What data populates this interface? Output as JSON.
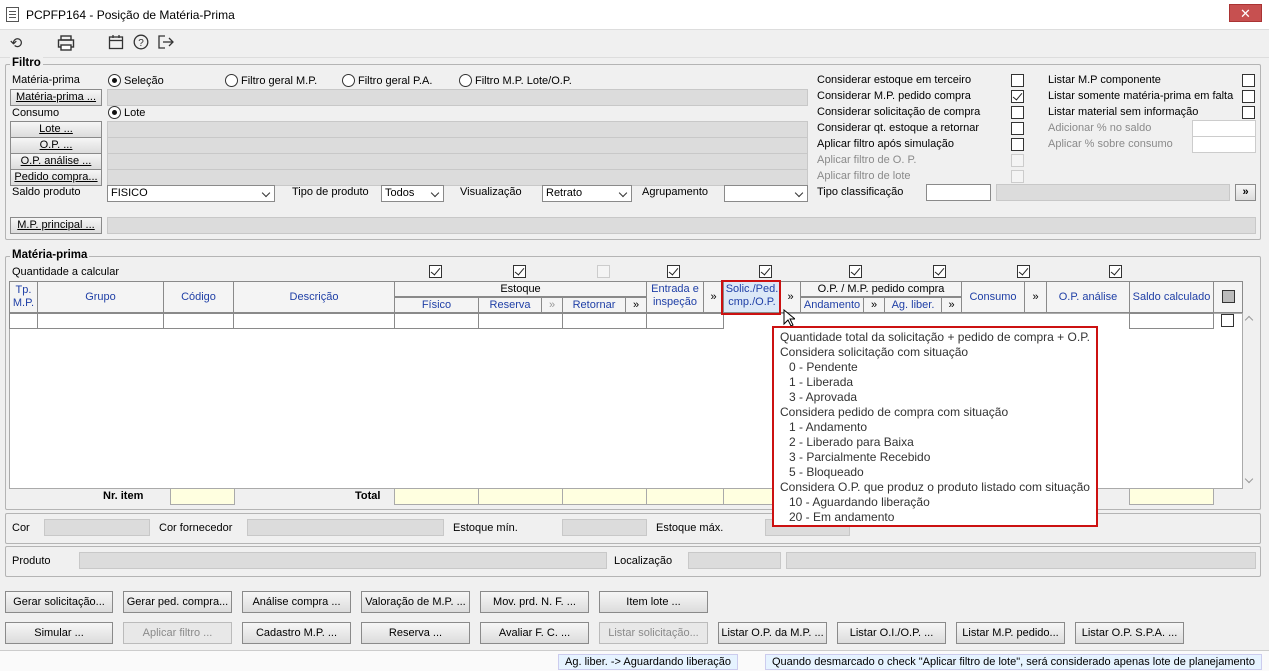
{
  "window": {
    "title": "PCPFP164 - Posição de Matéria-Prima",
    "close": "✕"
  },
  "toolbar": {
    "icons": [
      "refresh-icon",
      "print-icon",
      "calendar-icon",
      "help-icon",
      "exit-icon"
    ]
  },
  "filtro": {
    "title": "Filtro",
    "materia_prima_label": "Matéria-prima",
    "radios": [
      "Seleção",
      "Filtro geral M.P.",
      "Filtro geral P.A.",
      "Filtro M.P. Lote/O.P."
    ],
    "materia_prima_btn": "Matéria-prima ...",
    "consumo_label": "Consumo",
    "lote_radio": "Lote",
    "lote_btn": "Lote ...",
    "op_btn": "O.P. ...",
    "op_analise_btn": "O.P. análise ...",
    "pedido_btn": "Pedido compra...",
    "saldo_label": "Saldo produto",
    "saldo_value": "FISICO",
    "tipo_label": "Tipo de produto",
    "tipo_value": "Todos",
    "visual_label": "Visualização",
    "visual_value": "Retrato",
    "agrup_label": "Agrupamento",
    "agrup_value": "",
    "mp_principal_btn": "M.P. principal ...",
    "tipo_class_label": "Tipo classificação",
    "more": "»",
    "options_left": [
      {
        "label": "Considerar estoque em terceiro",
        "checked": false,
        "disabled": false
      },
      {
        "label": "Considerar M.P. pedido compra",
        "checked": true,
        "disabled": false
      },
      {
        "label": "Considerar solicitação de compra",
        "checked": false,
        "disabled": false
      },
      {
        "label": "Considerar qt. estoque a retornar",
        "checked": false,
        "disabled": false
      },
      {
        "label": "Aplicar filtro após simulação",
        "checked": false,
        "disabled": false
      },
      {
        "label": "Aplicar filtro de O. P.",
        "checked": false,
        "disabled": true
      },
      {
        "label": "Aplicar filtro de lote",
        "checked": false,
        "disabled": true
      }
    ],
    "options_right": [
      {
        "label": "Listar M.P componente",
        "checked": false,
        "disabled": false
      },
      {
        "label": "Listar somente matéria-prima em falta",
        "checked": false,
        "disabled": false
      },
      {
        "label": "Listar material sem informação",
        "checked": false,
        "disabled": false
      },
      {
        "label": "Adicionar % no saldo",
        "disabled": true
      },
      {
        "label": "Aplicar % sobre consumo",
        "disabled": true
      }
    ]
  },
  "materia": {
    "title": "Matéria-prima",
    "qtd_label": "Quantidade a calcular",
    "headers": {
      "tp": "Tp. M.P.",
      "grupo": "Grupo",
      "codigo": "Código",
      "descricao": "Descrição",
      "estoque": "Estoque",
      "fisico": "Físico",
      "reserva": "Reserva",
      "retornar": "Retornar",
      "entrada": "Entrada e inspeção",
      "solic": "Solic./Ped. cmp./O.P.",
      "op_mp": "O.P. / M.P. pedido compra",
      "andamento": "Andamento",
      "ag_liber": "Ag. liber.",
      "consumo": "Consumo",
      "op_analise": "O.P. análise",
      "saldo": "Saldo calculado",
      "more": "»"
    },
    "nr_item": "Nr. item",
    "total": "Total"
  },
  "tooltip": {
    "lines": [
      {
        "t": "Quantidade total da solicitação + pedido de compra + O.P.",
        "i": false
      },
      {
        "t": "Considera solicitação com situação",
        "i": false
      },
      {
        "t": "0 - Pendente",
        "i": true
      },
      {
        "t": "1 - Liberada",
        "i": true
      },
      {
        "t": "3 - Aprovada",
        "i": true
      },
      {
        "t": "Considera pedido de compra com situação",
        "i": false
      },
      {
        "t": "1 - Andamento",
        "i": true
      },
      {
        "t": "2 - Liberado para Baixa",
        "i": true
      },
      {
        "t": "3 - Parcialmente Recebido",
        "i": true
      },
      {
        "t": "5 - Bloqueado",
        "i": true
      },
      {
        "t": "Considera O.P. que produz o produto listado com situação",
        "i": false
      },
      {
        "t": "10 - Aguardando liberação",
        "i": true
      },
      {
        "t": "20 - Em andamento",
        "i": true
      }
    ]
  },
  "detail": {
    "cor": "Cor",
    "cor_forn": "Cor fornecedor",
    "est_min": "Estoque mín.",
    "est_max": "Estoque máx.",
    "produto": "Produto",
    "localizacao": "Localização"
  },
  "buttons": {
    "row1": [
      "Gerar solicitação...",
      "Gerar ped. compra...",
      "Análise compra ...",
      "Valoração de M.P. ...",
      "Mov. prd. N. F. ...",
      "Item lote ..."
    ],
    "row2": [
      "Simular ...",
      "Aplicar filtro ...",
      "Cadastro M.P. ...",
      "Reserva ...",
      "Avaliar F. C. ...",
      "Listar solicitação...",
      "Listar O.P. da M.P. ...",
      "Listar O.I./O.P. ...",
      "Listar M.P. pedido...",
      "Listar O.P. S.P.A. ..."
    ]
  },
  "status": {
    "left": "Ag. liber. -> Aguardando liberação",
    "right": "Quando desmarcado o check \"Aplicar filtro de lote\", será considerado apenas lote de planejamento"
  }
}
